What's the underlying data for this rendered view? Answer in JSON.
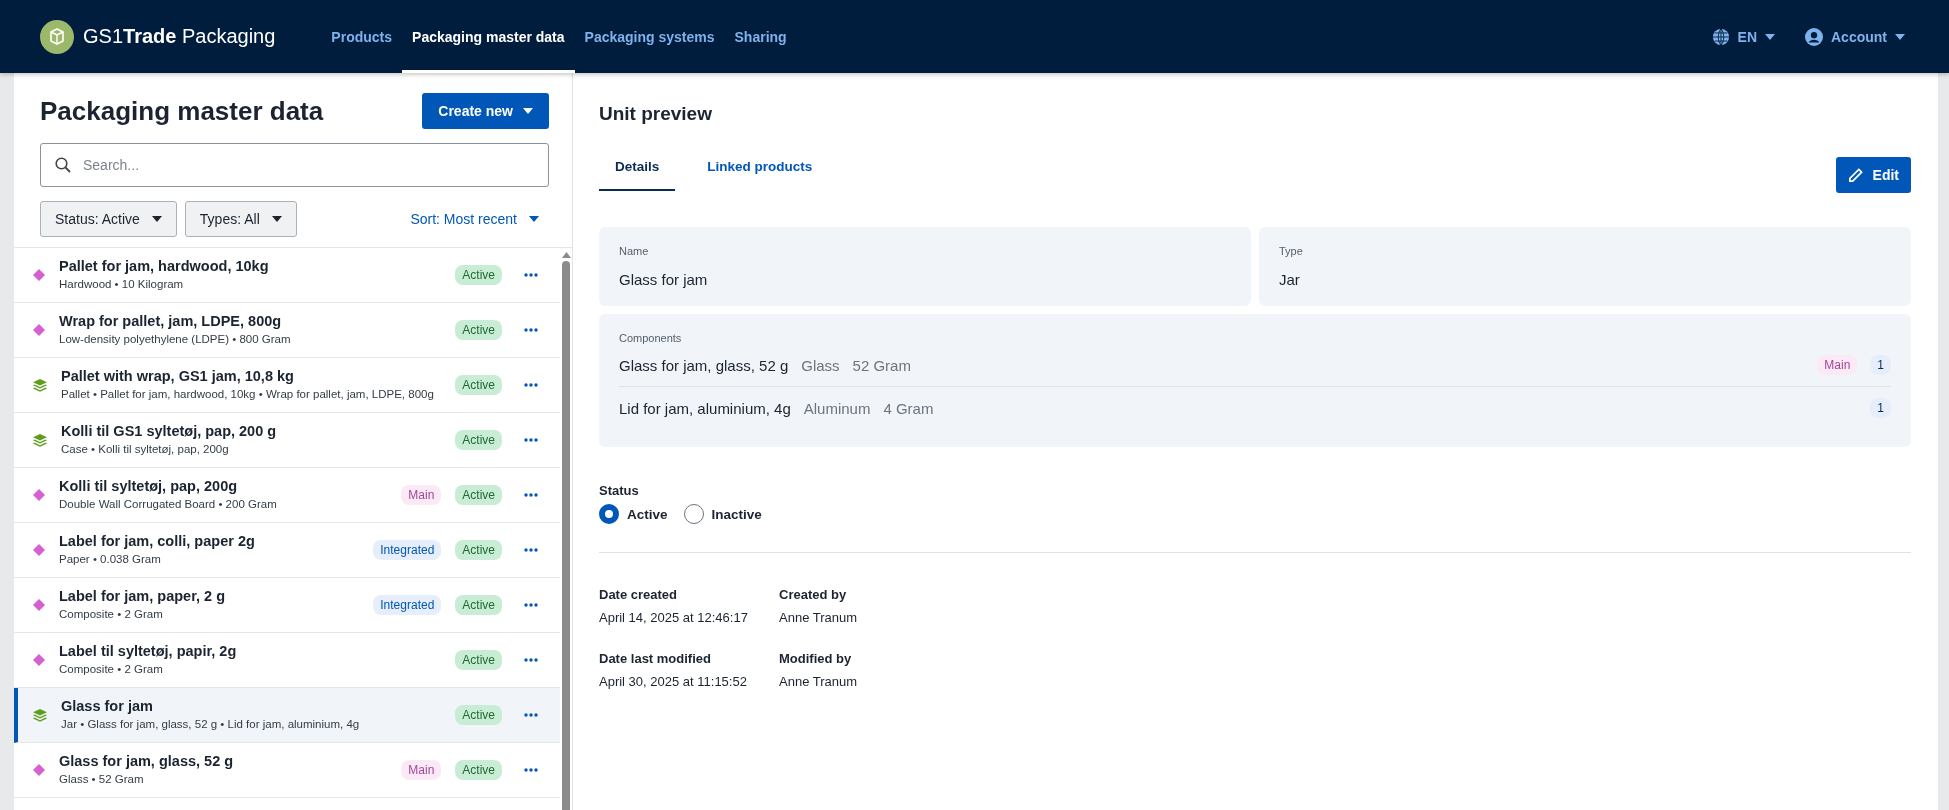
{
  "header": {
    "brand": {
      "prefix": "GS1",
      "bold": "Trade",
      "suffix": " Packaging"
    },
    "nav": [
      {
        "label": "Products",
        "selected": false
      },
      {
        "label": "Packaging master data",
        "selected": true
      },
      {
        "label": "Packaging systems",
        "selected": false
      },
      {
        "label": "Sharing",
        "selected": false
      }
    ],
    "language": "EN",
    "account": "Account"
  },
  "list_panel": {
    "title": "Packaging master data",
    "create_button": "Create new",
    "search": {
      "placeholder": "Search..."
    },
    "filters": [
      "Status: Active",
      "Types: All"
    ],
    "sort": "Sort: Most recent",
    "items": [
      {
        "kind": "unit",
        "title": "Pallet for jam, hardwood, 10kg",
        "subtitle": "Hardwood • 10 Kilogram",
        "status": "Active",
        "selected": false
      },
      {
        "kind": "unit",
        "title": "Wrap for pallet, jam, LDPE, 800g",
        "subtitle": "Low-density polyethylene (LDPE) • 800 Gram",
        "status": "Active",
        "selected": false
      },
      {
        "kind": "system",
        "title": "Pallet with wrap, GS1 jam, 10,8 kg",
        "subtitle": "Pallet • Pallet for jam, hardwood, 10kg • Wrap for pallet, jam, LDPE, 800g",
        "status": "Active",
        "selected": false
      },
      {
        "kind": "system",
        "title": "Kolli til GS1 syltetøj, pap, 200 g",
        "subtitle": "Case • Kolli til syltetøj, pap, 200g",
        "status": "Active",
        "selected": false
      },
      {
        "kind": "unit",
        "title": "Kolli til syltetøj, pap, 200g",
        "subtitle": "Double Wall Corrugated Board • 200 Gram",
        "tags": [
          {
            "kind": "main",
            "label": "Main"
          }
        ],
        "status": "Active",
        "selected": false
      },
      {
        "kind": "unit",
        "title": "Label for jam, colli, paper 2g",
        "subtitle": "Paper • 0.038 Gram",
        "tags": [
          {
            "kind": "integrated",
            "label": "Integrated"
          }
        ],
        "status": "Active",
        "selected": false
      },
      {
        "kind": "unit",
        "title": "Label for jam, paper, 2 g",
        "subtitle": "Composite • 2 Gram",
        "tags": [
          {
            "kind": "integrated",
            "label": "Integrated"
          }
        ],
        "status": "Active",
        "selected": false
      },
      {
        "kind": "unit",
        "title": "Label til syltetøj, papir, 2g",
        "subtitle": "Composite • 2 Gram",
        "status": "Active",
        "selected": false
      },
      {
        "kind": "system",
        "title": "Glass for jam",
        "subtitle": "Jar • Glass for jam, glass, 52 g • Lid for jam, aluminium, 4g",
        "status": "Active",
        "selected": true
      },
      {
        "kind": "unit",
        "title": "Glass for jam, glass, 52 g",
        "subtitle": "Glass • 52 Gram",
        "tags": [
          {
            "kind": "main",
            "label": "Main"
          }
        ],
        "status": "Active",
        "selected": false
      }
    ]
  },
  "preview": {
    "title": "Unit preview",
    "tabs": [
      {
        "label": "Details",
        "selected": true
      },
      {
        "label": "Linked products",
        "selected": false
      }
    ],
    "edit_button": "Edit",
    "name": {
      "label": "Name",
      "value": "Glass for jam"
    },
    "type": {
      "label": "Type",
      "value": "Jar"
    },
    "components": {
      "label": "Components",
      "items": [
        {
          "name": "Glass for jam, glass, 52 g",
          "material": "Glass",
          "weight": "52 Gram",
          "tags": [
            {
              "kind": "main",
              "label": "Main"
            }
          ],
          "count": "1"
        },
        {
          "name": "Lid for jam, aluminium, 4g",
          "material": "Aluminum",
          "weight": "4 Gram",
          "count": "1"
        }
      ]
    },
    "status": {
      "label": "Status",
      "options": [
        {
          "label": "Active",
          "selected": true
        },
        {
          "label": "Inactive",
          "selected": false
        }
      ]
    },
    "meta": [
      {
        "label": "Date created",
        "value": "April 14, 2025 at 12:46:17"
      },
      {
        "label": "Created by",
        "value": "Anne Tranum"
      },
      {
        "label": "Date last modified",
        "value": "April 30, 2025 at 11:15:52"
      },
      {
        "label": "Modified by",
        "value": "Anne Tranum"
      }
    ]
  }
}
